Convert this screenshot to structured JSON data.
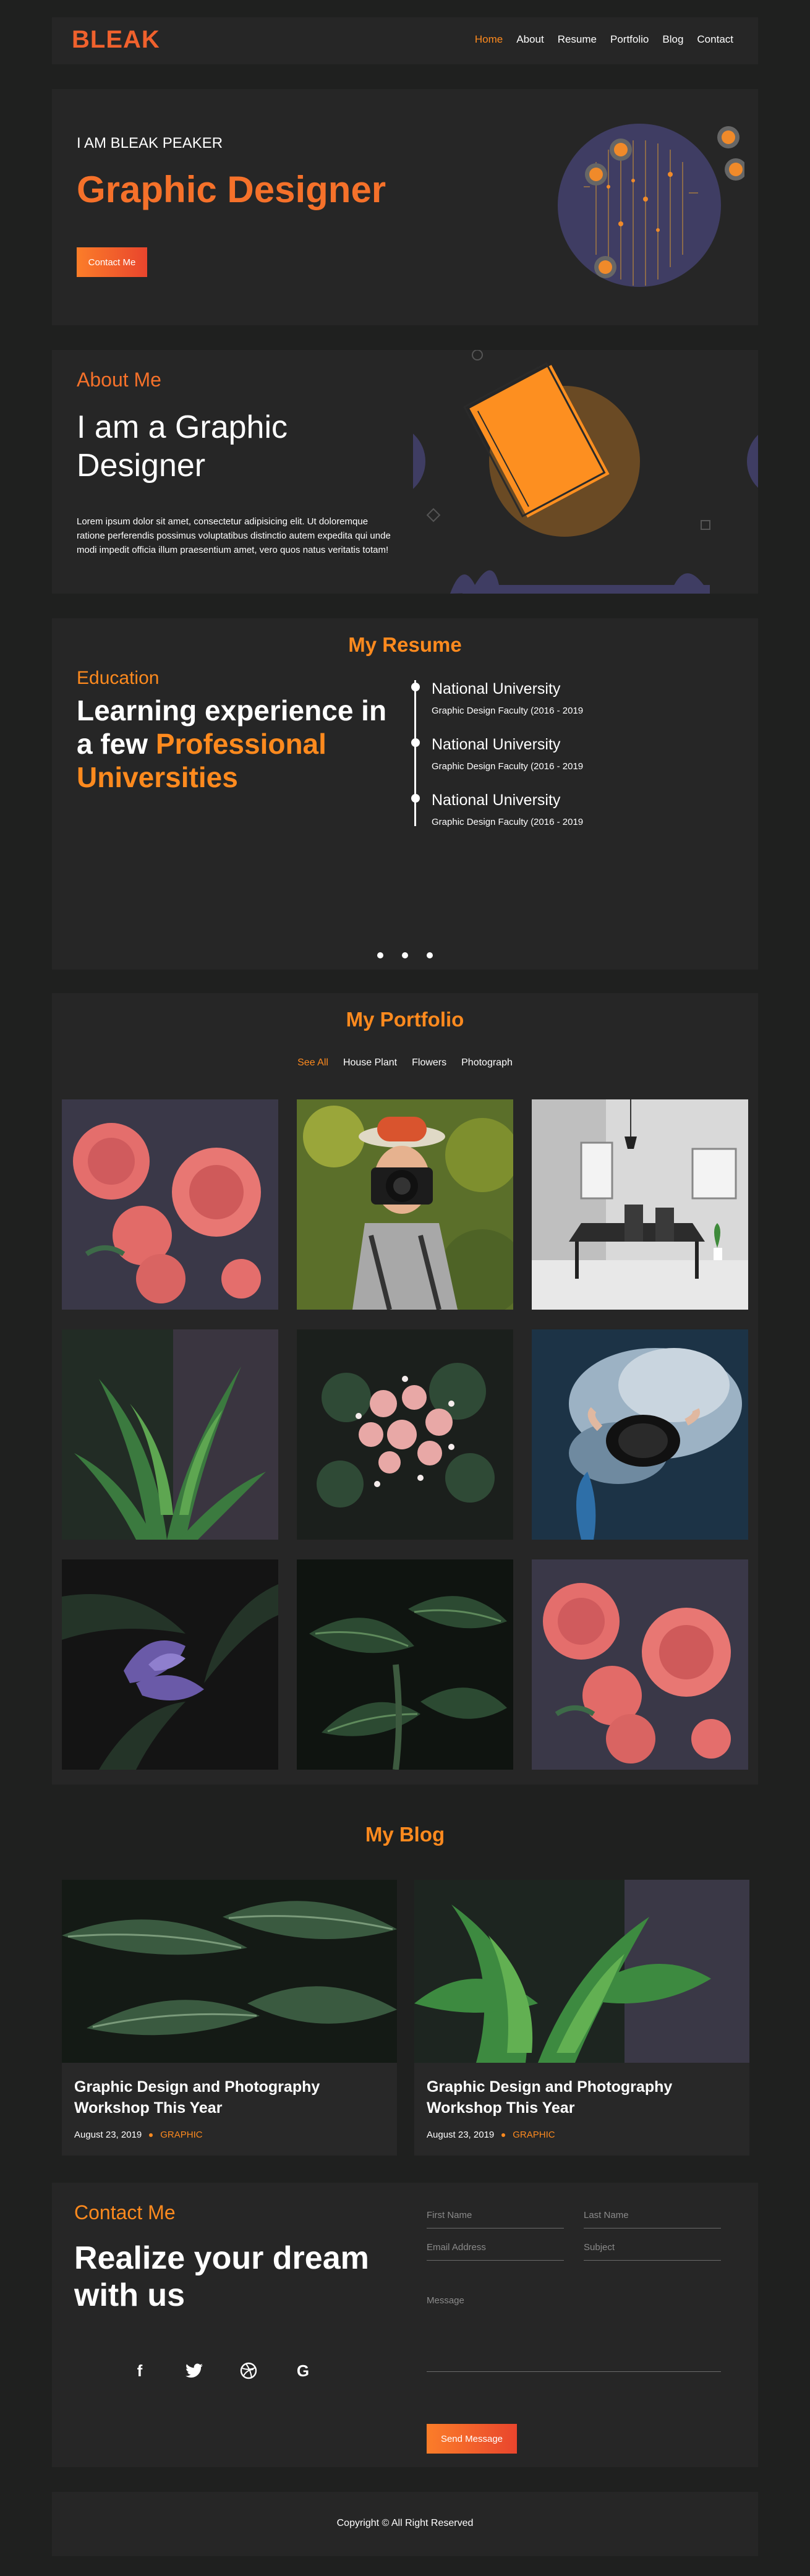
{
  "header": {
    "logo": "BLEAK",
    "nav": [
      "Home",
      "About",
      "Resume",
      "Portfolio",
      "Blog",
      "Contact"
    ]
  },
  "hero": {
    "subtitle": "I AM BLEAK PEAKER",
    "title": "Graphic Designer",
    "button": "Contact Me"
  },
  "about": {
    "tag": "About Me",
    "heading": "I am a Graphic Designer",
    "text": "Lorem ipsum dolor sit amet, consectetur adipisicing elit. Ut doloremque ratione perferendis possimus voluptatibus distinctio autem expedita qui unde modi impedit officia illum praesentium amet, vero quos natus veritatis totam!"
  },
  "resume": {
    "title": "My Resume",
    "tag": "Education",
    "heading_plain": "Learning experience in a few",
    "heading_accent": "Professional Universities",
    "items": [
      {
        "name": "National University",
        "detail": "Graphic Design Faculty (2016 - 2019"
      },
      {
        "name": "National University",
        "detail": "Graphic Design Faculty (2016 - 2019"
      },
      {
        "name": "National University",
        "detail": "Graphic Design Faculty (2016 - 2019"
      }
    ]
  },
  "portfolio": {
    "title": "My Portfolio",
    "filters": [
      "See All",
      "House Plant",
      "Flowers",
      "Photograph"
    ]
  },
  "blog": {
    "title": "My Blog",
    "posts": [
      {
        "title": "Graphic Design and Photography Workshop This Year",
        "date": "August 23, 2019",
        "category": "GRAPHIC"
      },
      {
        "title": "Graphic Design and Photography Workshop This Year",
        "date": "August 23, 2019",
        "category": "GRAPHIC"
      }
    ]
  },
  "contact": {
    "tag": "Contact Me",
    "heading": "Realize your dream with us",
    "first_name": "First Name",
    "last_name": "Last Name",
    "email": "Email Address",
    "subject": "Subject",
    "message": "Message",
    "button": "Send Message",
    "social": [
      "facebook-icon",
      "twitter-icon",
      "dribbble-icon",
      "google-icon"
    ]
  },
  "footer": {
    "copyright": "Copyright © All Right Reserved"
  },
  "colors": {
    "accent": "#fe8a1e",
    "accent_dark": "#e9452d",
    "background": "#1f201f",
    "card": "#262626"
  }
}
